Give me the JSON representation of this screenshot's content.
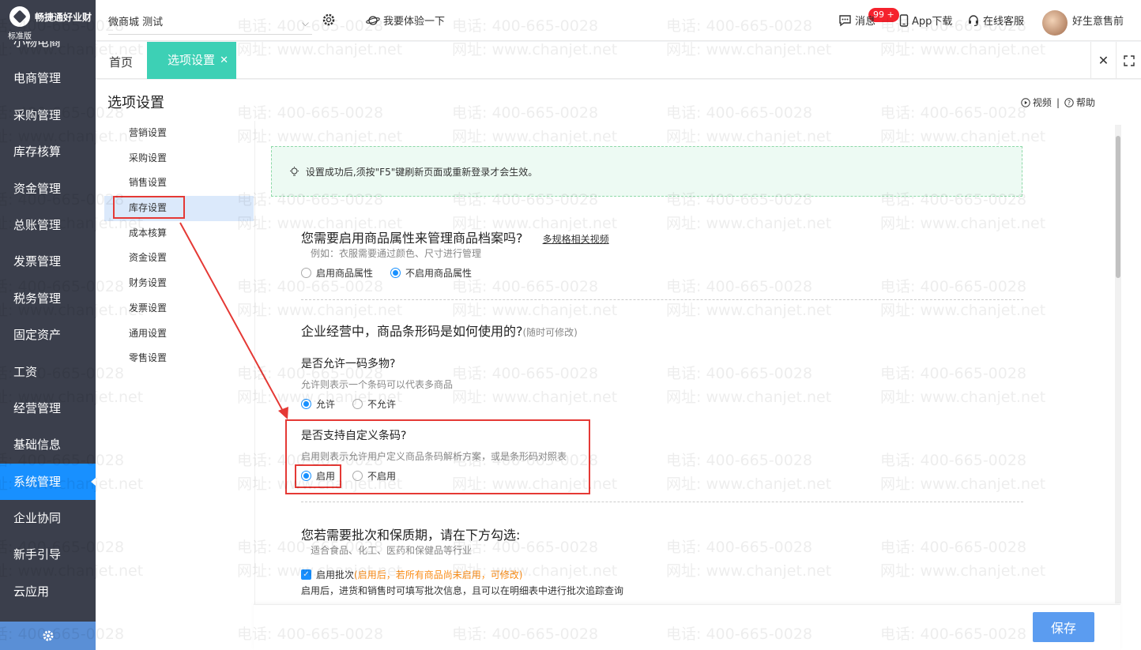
{
  "app": {
    "brand": "畅捷通好业财",
    "edition": "标准版"
  },
  "sidebar": {
    "items": [
      {
        "label": "小畅电商"
      },
      {
        "label": "电商管理"
      },
      {
        "label": "采购管理"
      },
      {
        "label": "库存核算"
      },
      {
        "label": "资金管理"
      },
      {
        "label": "总账管理"
      },
      {
        "label": "发票管理"
      },
      {
        "label": "税务管理"
      },
      {
        "label": "固定资产"
      },
      {
        "label": "工资"
      },
      {
        "label": "经营管理"
      },
      {
        "label": "基础信息"
      },
      {
        "label": "系统管理",
        "active": true
      },
      {
        "label": "企业协同"
      },
      {
        "label": "新手引导"
      },
      {
        "label": "云应用"
      }
    ]
  },
  "topbar": {
    "store_select": "微商城 测试",
    "try_label": "我要体验一下",
    "badge": "99 +",
    "messages": "消息",
    "app_download": "App下载",
    "online_service": "在线客服",
    "user_name": "好生意售前"
  },
  "tabs": {
    "home": "首页",
    "active": "选项设置",
    "close": "✕"
  },
  "page": {
    "title": "选项设置",
    "video": "视频",
    "help": "帮助",
    "subnav": [
      "营销设置",
      "采购设置",
      "销售设置",
      "库存设置",
      "成本核算",
      "资金设置",
      "财务设置",
      "发票设置",
      "通用设置",
      "零售设置"
    ],
    "subnav_active_index": 3,
    "notice": "设置成功后,须按\"F5\"键刷新页面或重新登录才会生效。",
    "q1": {
      "title": "您需要启用商品属性来管理商品档案吗?",
      "link": "多规格相关视频",
      "sub": "例如：衣服需要通过颜色、尺寸进行管理",
      "opt_a": "启用商品属性",
      "opt_b": "不启用商品属性",
      "selected": "b"
    },
    "q2": {
      "title": "企业经营中，商品条形码是如何使用的?",
      "hint": "(随时可修改)",
      "sub_title": "是否允许一码多物?",
      "sub_desc": "允许则表示一个条码可以代表多商品",
      "opt_a": "允许",
      "opt_b": "不允许",
      "selected": "a"
    },
    "q3": {
      "title": "是否支持自定义条码?",
      "desc": "启用则表示允许用户定义商品条码解析方案，或是条形码对照表",
      "opt_a": "启用",
      "opt_b": "不启用",
      "selected": "a"
    },
    "q4": {
      "title": "您若需要批次和保质期，请在下方勾选:",
      "sub": "适合食品、化工、医药和保健品等行业",
      "check_label": "启用批次",
      "check_note": "(启用后，若所有商品尚未启用，可修改)",
      "check_desc": "启用后，进货和销售时可填写批次信息，且可以在明细表中进行批次追踪查询",
      "checked": true
    },
    "save": "保存"
  },
  "watermark": {
    "phone": "电话: 400-665-0028",
    "site": "网址: www.chanjet.net"
  },
  "colors": {
    "sidebar": "#3b3f4c",
    "accent": "#1890ff",
    "tab_active": "#3dd0b5",
    "annotation": "#e53935"
  }
}
